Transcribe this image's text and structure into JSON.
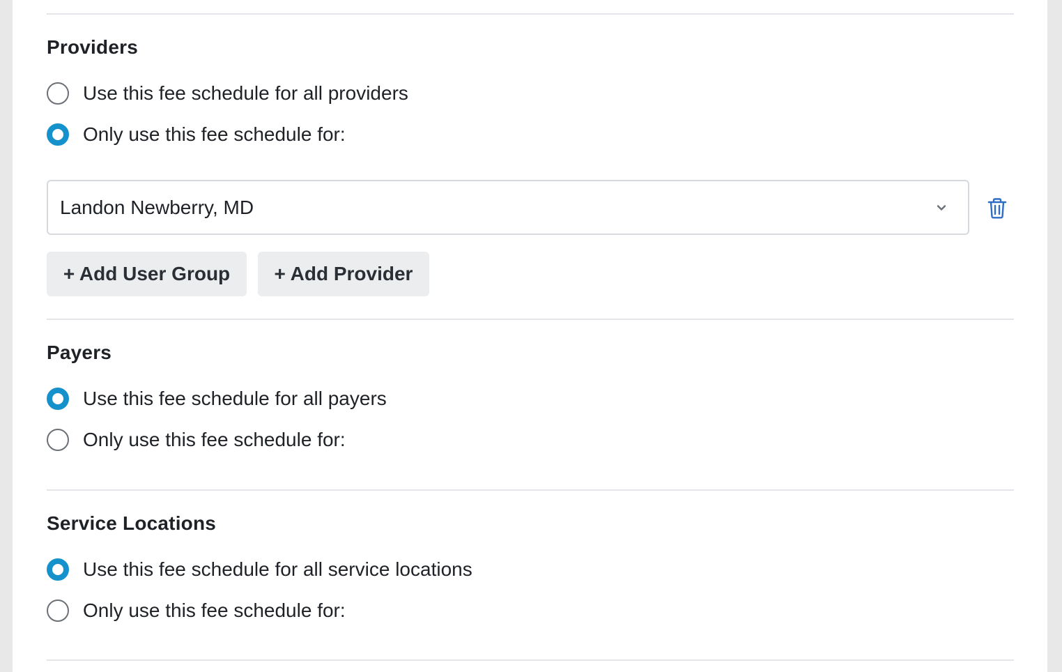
{
  "providers": {
    "title": "Providers",
    "option_all": "Use this fee schedule for all providers",
    "option_only": "Only use this fee schedule for:",
    "selected": "only",
    "provider_select_value": "Landon Newberry, MD",
    "add_user_group_label": "+ Add User Group",
    "add_provider_label": "+ Add Provider"
  },
  "payers": {
    "title": "Payers",
    "option_all": "Use this fee schedule for all payers",
    "option_only": "Only use this fee schedule for:",
    "selected": "all"
  },
  "service_locations": {
    "title": "Service Locations",
    "option_all": "Use this fee schedule for all service locations",
    "option_only": "Only use this fee schedule for:",
    "selected": "all"
  },
  "icons": {
    "chevron": "chevron-down-icon",
    "trash": "trash-icon"
  },
  "colors": {
    "accent": "#1591cc",
    "trash_icon": "#2f6dc4",
    "button_bg": "#ebedef",
    "divider": "#e3e5e8"
  }
}
